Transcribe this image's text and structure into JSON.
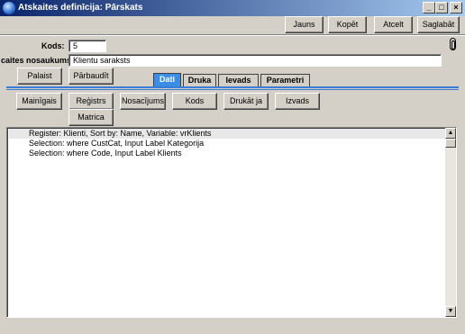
{
  "window": {
    "title": "Atskaites definīcija: Pārskats",
    "minimize": "_",
    "maximize": "□",
    "close": "×"
  },
  "toolbar": {
    "new": "Jauns",
    "copy": "Kopēt",
    "cancel": "Atcelt",
    "save": "Saglabāt"
  },
  "form": {
    "code_label": "Kods:",
    "code_value": "5",
    "name_label": "caites nosaukums:",
    "name_value": "Klientu saraksts"
  },
  "actions": {
    "run": "Palaist",
    "check": "Pārbaudīt"
  },
  "tabs": [
    "Dati",
    "Druka",
    "Ievads",
    "Parametri"
  ],
  "active_tab": "Dati",
  "insert_buttons": {
    "variable": "Mainīgais",
    "register": "Reģistrs",
    "condition": "Nosacījums",
    "code": "Kods",
    "print_if": "Drukāt ja",
    "output": "Izvads",
    "matrix": "Matrica"
  },
  "definition_lines": [
    "Register: Klienti, Sort by: Name, Variable: vrKlients",
    "Selection: where CustCat, Input Label Kategorija",
    "Selection: where Code, Input Label Klients"
  ],
  "scrollbar": {
    "up": "▲",
    "down": "▼"
  }
}
